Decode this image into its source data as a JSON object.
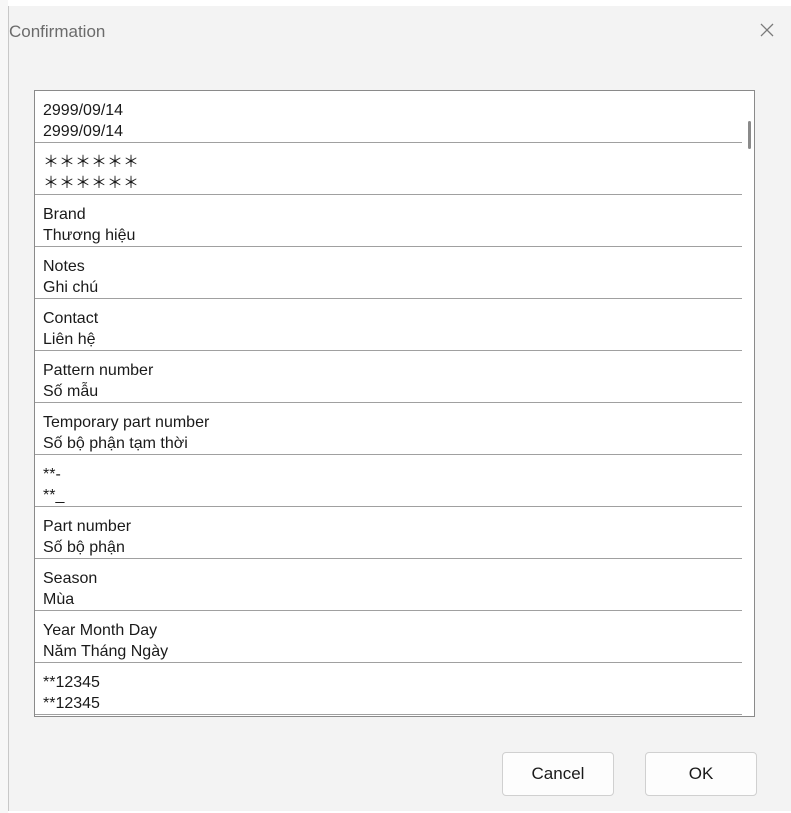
{
  "dialog": {
    "title": "Confirmation",
    "close_icon": "close-icon"
  },
  "list": {
    "items": [
      {
        "line1": "2999/09/14",
        "line2": "2999/09/14"
      },
      {
        "line1": "＊＊＊＊＊＊",
        "line2": "＊＊＊＊＊＊"
      },
      {
        "line1": "Brand",
        "line2": "Thương hiệu"
      },
      {
        "line1": "Notes",
        "line2": "Ghi chú"
      },
      {
        "line1": "Contact",
        "line2": "Liên hệ"
      },
      {
        "line1": "Pattern number",
        "line2": "Số mẫu"
      },
      {
        "line1": "Temporary part number",
        "line2": "Số bộ phận tạm thời"
      },
      {
        "line1": "**-",
        "line2": "**_"
      },
      {
        "line1": "Part number",
        "line2": "Số bộ phận"
      },
      {
        "line1": "Season",
        "line2": "Mùa"
      },
      {
        "line1": "Year Month Day",
        "line2": "Năm Tháng Ngày"
      },
      {
        "line1": "**12345",
        "line2": "**12345"
      }
    ]
  },
  "buttons": {
    "cancel_label": "Cancel",
    "ok_label": "OK"
  }
}
